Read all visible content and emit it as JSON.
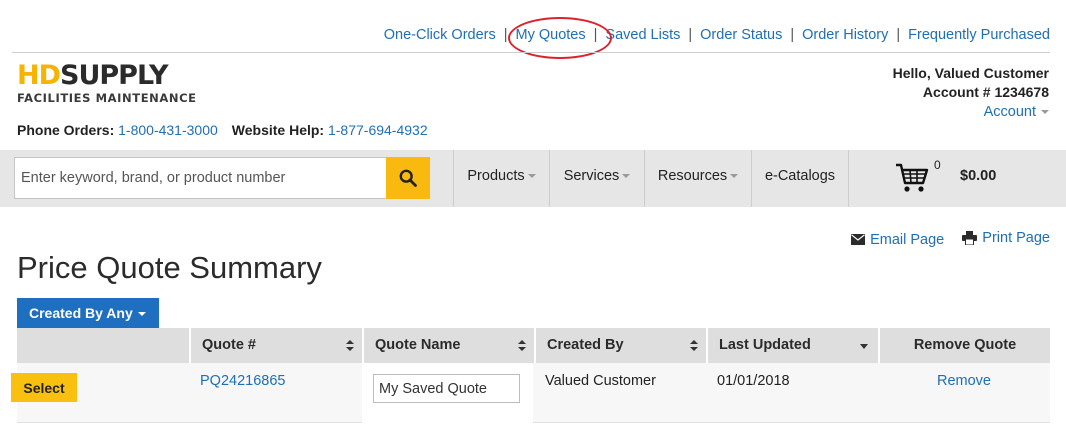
{
  "top_links": [
    "One-Click Orders",
    "My Quotes",
    "Saved Lists",
    "Order Status",
    "Order History",
    "Frequently Purchased"
  ],
  "logo": {
    "line1_hd": "HD",
    "line1_rest": "SUPPLY",
    "line2": "FACILITIES MAINTENANCE"
  },
  "account": {
    "greeting": "Hello, Valued Customer",
    "number": "Account # 1234678",
    "menu_label": "Account"
  },
  "phone": {
    "orders_label": "Phone Orders:",
    "orders_number": "1-800-431-3000",
    "help_label": "Website Help:",
    "help_number": "1-877-694-4932"
  },
  "search": {
    "placeholder": "Enter keyword, brand, or product number"
  },
  "nav": {
    "products": "Products",
    "services": "Services",
    "resources": "Resources",
    "ecatalogs": "e-Catalogs"
  },
  "cart": {
    "count": "0",
    "total": "$0.00"
  },
  "page_actions": {
    "email": "Email Page",
    "print": "Print Page"
  },
  "page_title": "Price Quote Summary",
  "filter": {
    "created_by": "Created By Any"
  },
  "table": {
    "headers": {
      "quote_num": "Quote #",
      "quote_name": "Quote Name",
      "created_by": "Created By",
      "last_updated": "Last Updated",
      "remove": "Remove Quote"
    },
    "rows": [
      {
        "select_label": "Select",
        "quote_num": "PQ24216865",
        "quote_name": "My Saved Quote",
        "created_by": "Valued Customer",
        "last_updated": "01/01/2018",
        "remove_label": "Remove"
      }
    ]
  },
  "colors": {
    "accent_blue": "#1f6fb2",
    "brand_yellow": "#f9b90f",
    "highlight_red": "#d9232e"
  }
}
